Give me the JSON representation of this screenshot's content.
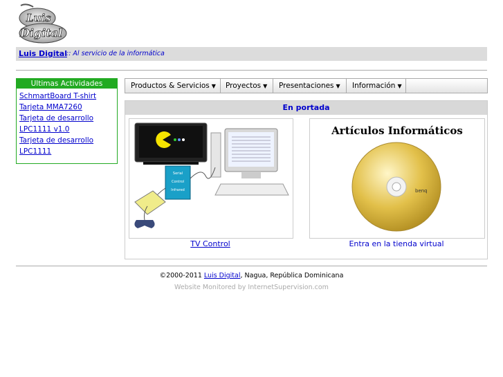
{
  "header": {
    "logo_text_top": "Luis",
    "logo_text_bottom": "Digital",
    "brand": "Luis Digital",
    "slogan": ":: Al servicio de la informática"
  },
  "sidebar": {
    "title": "Ultimas Actividades",
    "items": [
      {
        "label": "SchmartBoard T-shirt"
      },
      {
        "label": "Tarjeta MMA7260"
      },
      {
        "label": "Tarjeta de desarrollo LPC1111 v1.0"
      },
      {
        "label": "Tarjeta de desarrollo LPC1111"
      }
    ]
  },
  "menu": {
    "items": [
      {
        "label": "Productos & Servicios"
      },
      {
        "label": "Proyectos"
      },
      {
        "label": "Presentaciones"
      },
      {
        "label": "Información"
      }
    ]
  },
  "featured": {
    "title": "En portada",
    "left": {
      "caption": "TV Control",
      "box_lines": [
        "Serial",
        "Control",
        "Infrared"
      ]
    },
    "right": {
      "heading": "Artículos Informáticos",
      "disc_brand": "benq",
      "caption": "Entra en la tienda virtual"
    }
  },
  "footer": {
    "copyright_prefix": "©2000-2011",
    "link": "Luis Digital",
    "location": ", Nagua, República Dominicana",
    "monitor": "Website Monitored by InternetSupervision.com"
  },
  "colors": {
    "link": "#0000cc",
    "sidebar_accent": "#22aa22",
    "bar_gray": "#dcdcdc"
  }
}
